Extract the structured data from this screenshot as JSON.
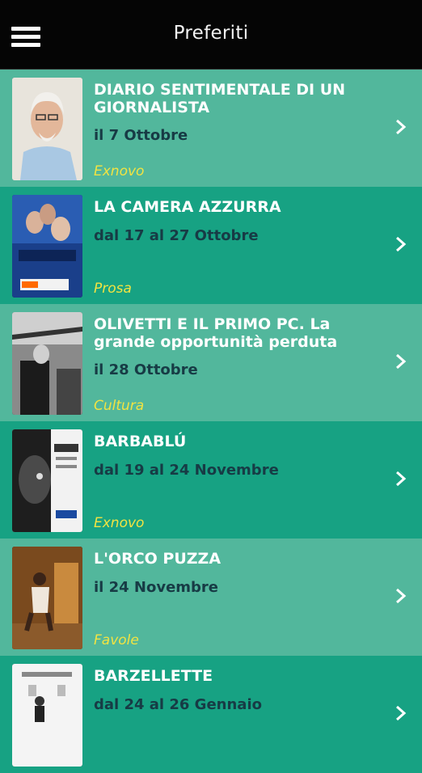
{
  "header": {
    "title": "Preferiti",
    "menu_icon": "hamburger-menu-icon"
  },
  "colors": {
    "row_light": "#52b79c",
    "row_dark": "#17a283",
    "category": "#f1e342",
    "date": "#173b45"
  },
  "events": [
    {
      "title": "DIARIO SENTIMENTALE DI UN GIORNALISTA",
      "date": "il 7 Ottobre",
      "category": "Exnovo"
    },
    {
      "title": "LA CAMERA AZZURRA",
      "date": "dal 17 al 27 Ottobre",
      "category": "Prosa"
    },
    {
      "title": "OLIVETTI E IL PRIMO PC. La grande opportunità perduta",
      "date": "il 28 Ottobre",
      "category": "Cultura"
    },
    {
      "title": "BARBABLÚ",
      "date": "dal 19 al 24 Novembre",
      "category": "Exnovo"
    },
    {
      "title": "L'ORCO PUZZA",
      "date": "il 24 Novembre",
      "category": "Favole"
    },
    {
      "title": "BARZELLETTE",
      "date": "dal 24 al 26 Gennaio",
      "category": ""
    }
  ]
}
